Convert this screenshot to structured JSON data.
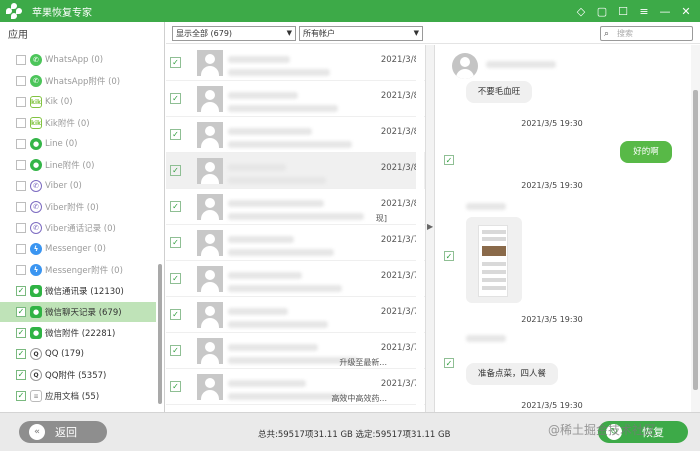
{
  "app": {
    "title": "苹果恢复专家",
    "title_icons": [
      "gem-icon",
      "register-icon",
      "feedback-icon",
      "menu-icon",
      "minimize-icon",
      "close-icon"
    ]
  },
  "sidebar": {
    "header": "应用",
    "items": [
      {
        "label": "WhatsApp (0)",
        "icon": "whatsapp-icon",
        "glyph": "✆",
        "icon_class": "ic-whatsapp",
        "checked": false,
        "active": false
      },
      {
        "label": "WhatsApp附件 (0)",
        "icon": "whatsapp-icon",
        "glyph": "✆",
        "icon_class": "ic-whatsapp",
        "checked": false,
        "active": false
      },
      {
        "label": "Kik (0)",
        "icon": "kik-icon",
        "glyph": "kik",
        "icon_class": "ic-kik",
        "checked": false,
        "active": false
      },
      {
        "label": "Kik附件 (0)",
        "icon": "kik-icon",
        "glyph": "kik",
        "icon_class": "ic-kik",
        "checked": false,
        "active": false
      },
      {
        "label": "Line (0)",
        "icon": "line-icon",
        "glyph": "●",
        "icon_class": "ic-line",
        "checked": false,
        "active": false
      },
      {
        "label": "Line附件 (0)",
        "icon": "line-icon",
        "glyph": "●",
        "icon_class": "ic-line",
        "checked": false,
        "active": false
      },
      {
        "label": "Viber (0)",
        "icon": "viber-icon",
        "glyph": "✆",
        "icon_class": "ic-viber",
        "checked": false,
        "active": false
      },
      {
        "label": "Viber附件 (0)",
        "icon": "viber-icon",
        "glyph": "✆",
        "icon_class": "ic-viber",
        "checked": false,
        "active": false
      },
      {
        "label": "Viber通话记录 (0)",
        "icon": "viber-icon",
        "glyph": "✆",
        "icon_class": "ic-viber",
        "checked": false,
        "active": false
      },
      {
        "label": "Messenger (0)",
        "icon": "messenger-icon",
        "glyph": "ϟ",
        "icon_class": "ic-messenger",
        "checked": false,
        "active": false
      },
      {
        "label": "Messenger附件 (0)",
        "icon": "messenger-icon",
        "glyph": "ϟ",
        "icon_class": "ic-messenger",
        "checked": false,
        "active": false
      },
      {
        "label": "微信通讯录 (12130)",
        "icon": "wechat-icon",
        "glyph": "●",
        "icon_class": "ic-wechat",
        "checked": true,
        "active": false
      },
      {
        "label": "微信聊天记录 (679)",
        "icon": "wechat-icon",
        "glyph": "●",
        "icon_class": "ic-wechat",
        "checked": true,
        "active": true
      },
      {
        "label": "微信附件 (22281)",
        "icon": "wechat-icon",
        "glyph": "●",
        "icon_class": "ic-wechat",
        "checked": true,
        "active": false
      },
      {
        "label": "QQ (179)",
        "icon": "qq-icon",
        "glyph": "Q",
        "icon_class": "ic-qq",
        "checked": true,
        "active": false
      },
      {
        "label": "QQ附件 (5357)",
        "icon": "qq-icon",
        "glyph": "Q",
        "icon_class": "ic-qq",
        "checked": true,
        "active": false
      },
      {
        "label": "应用文档 (55)",
        "icon": "document-icon",
        "glyph": "≡",
        "icon_class": "ic-doc",
        "checked": true,
        "active": false
      }
    ]
  },
  "toolbar": {
    "filter_select": "显示全部 (679)",
    "account_select": "所有帐户",
    "search_placeholder": "搜索"
  },
  "contacts": [
    {
      "date": "2021/3/8",
      "snippet": "",
      "highlight": false
    },
    {
      "date": "2021/3/8",
      "snippet": "",
      "highlight": false
    },
    {
      "date": "2021/3/8",
      "snippet": "",
      "highlight": false
    },
    {
      "date": "2021/3/8",
      "snippet": "",
      "highlight": true
    },
    {
      "date": "2021/3/8",
      "snippet": "现]",
      "highlight": false
    },
    {
      "date": "2021/3/7",
      "snippet": "",
      "highlight": false
    },
    {
      "date": "2021/3/7",
      "snippet": "",
      "highlight": false
    },
    {
      "date": "2021/3/7",
      "snippet": "",
      "highlight": false
    },
    {
      "date": "2021/3/7",
      "snippet": "升级至最新...",
      "highlight": false
    },
    {
      "date": "2021/3/7",
      "snippet": "高效中高效药...",
      "highlight": false
    }
  ],
  "chat": {
    "messages": [
      {
        "type": "in",
        "text": "不要毛血旺"
      },
      {
        "type": "time",
        "text": "2021/3/5 19:30"
      },
      {
        "type": "out",
        "text": "好的啊"
      },
      {
        "type": "time",
        "text": "2021/3/5 19:30"
      },
      {
        "type": "image",
        "text": ""
      },
      {
        "type": "time",
        "text": "2021/3/5 19:30"
      },
      {
        "type": "in",
        "text": "准备点菜，四人餐"
      },
      {
        "type": "time",
        "text": "2021/3/5 19:30"
      }
    ]
  },
  "footer": {
    "back_label": "返回",
    "status": "总共:59517项31.11 GB 选定:59517项31.11 GB",
    "recover_label": "恢复",
    "watermark": "@稀土掘金技术社区"
  },
  "colors": {
    "brand_green": "#3daa48",
    "active_row": "#bfe3b8",
    "bubble_out": "#58b947",
    "bubble_in": "#f0f0f0"
  }
}
